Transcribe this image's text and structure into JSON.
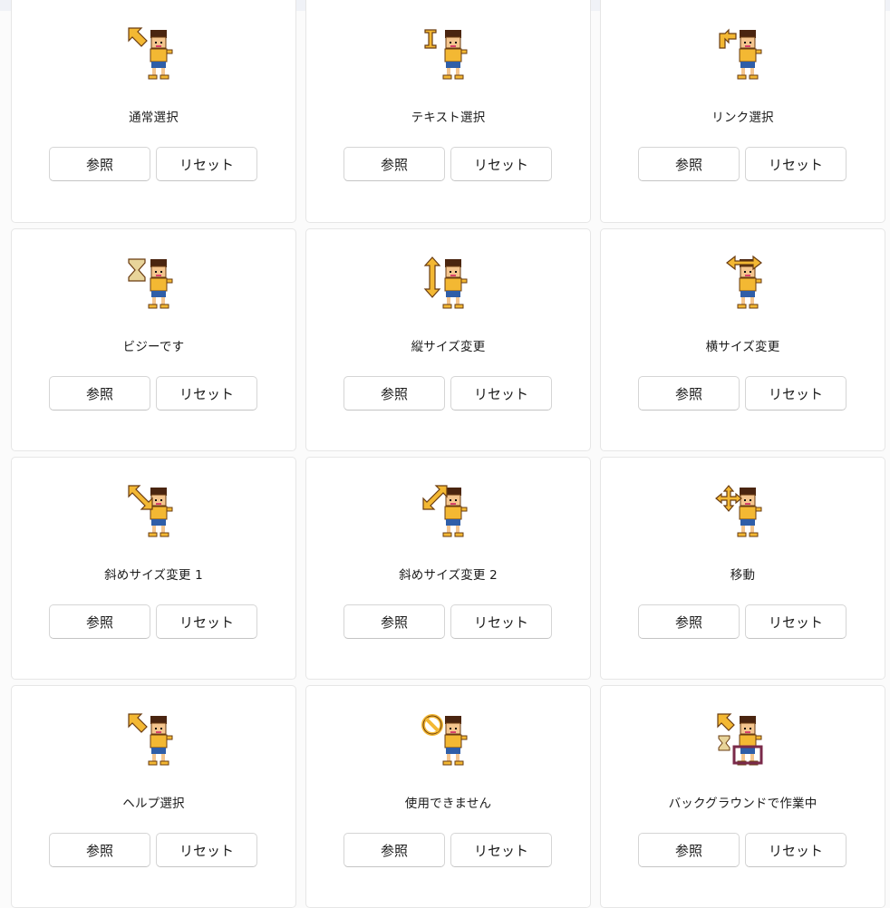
{
  "buttons": {
    "browse": "参照",
    "reset": "リセット"
  },
  "cursors": [
    {
      "label": "通常選択",
      "icon": "arrow-nw",
      "icon_name": "normal-select-cursor-icon"
    },
    {
      "label": "テキスト選択",
      "icon": "ibeam",
      "icon_name": "text-select-cursor-icon"
    },
    {
      "label": "リンク選択",
      "icon": "link",
      "icon_name": "link-select-cursor-icon"
    },
    {
      "label": "ビジーです",
      "icon": "hourglass",
      "icon_name": "busy-cursor-icon"
    },
    {
      "label": "縦サイズ変更",
      "icon": "vertical",
      "icon_name": "vertical-resize-cursor-icon"
    },
    {
      "label": "横サイズ変更",
      "icon": "horizontal",
      "icon_name": "horizontal-resize-cursor-icon"
    },
    {
      "label": "斜めサイズ変更 1",
      "icon": "diag1",
      "icon_name": "diagonal-resize-1-cursor-icon"
    },
    {
      "label": "斜めサイズ変更 2",
      "icon": "diag2",
      "icon_name": "diagonal-resize-2-cursor-icon"
    },
    {
      "label": "移動",
      "icon": "move",
      "icon_name": "move-cursor-icon"
    },
    {
      "label": "ヘルプ選択",
      "icon": "arrow-nw",
      "icon_name": "help-select-cursor-icon"
    },
    {
      "label": "使用できません",
      "icon": "no",
      "icon_name": "unavailable-cursor-icon"
    },
    {
      "label": "バックグラウンドで作業中",
      "icon": "working",
      "icon_name": "working-in-background-cursor-icon"
    }
  ],
  "colors": {
    "accent": "#f3b833",
    "outline": "#6a3c12",
    "hair": "#4a2510",
    "shorts": "#2f5ea8",
    "skin": "#f4c58e",
    "busy_box": "#7a2a4a"
  }
}
